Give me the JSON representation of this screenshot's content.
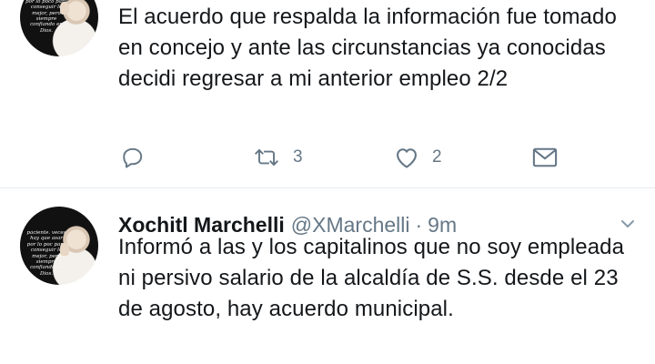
{
  "tweet1": {
    "avatar_caption": "paciente. veces hay que esar por lo poco para conseguir lo mejor, pero siempre confiando en Dios.",
    "text": "El acuerdo que respalda la información fue tomado en concejo y ante las circunstancias ya conocidas decidi regresar a mi anterior empleo 2/2",
    "actions": {
      "reply_icon": "reply-icon",
      "retweet_icon": "retweet-icon",
      "retweet_count": "3",
      "like_icon": "heart-icon",
      "like_count": "2",
      "dm_icon": "envelope-icon"
    }
  },
  "tweet2": {
    "avatar_caption": "paciente. veces hay que asar por lo poc para conseguir lo mejor, pero siempre confiando en Dios.",
    "display_name": "Xochitl Marchelli",
    "handle": "@XMarchelli",
    "separator": "·",
    "time": "9m",
    "caret_icon": "chevron-down-icon",
    "text": "Informó a las y los capitalinos que no soy empleada ni persivo salario de la alcaldía de S.S. desde el 23 de agosto, hay acuerdo municipal."
  },
  "colors": {
    "text": "#14171a",
    "secondary": "#657786",
    "divider": "#e6ecf0",
    "background": "#ffffff"
  }
}
